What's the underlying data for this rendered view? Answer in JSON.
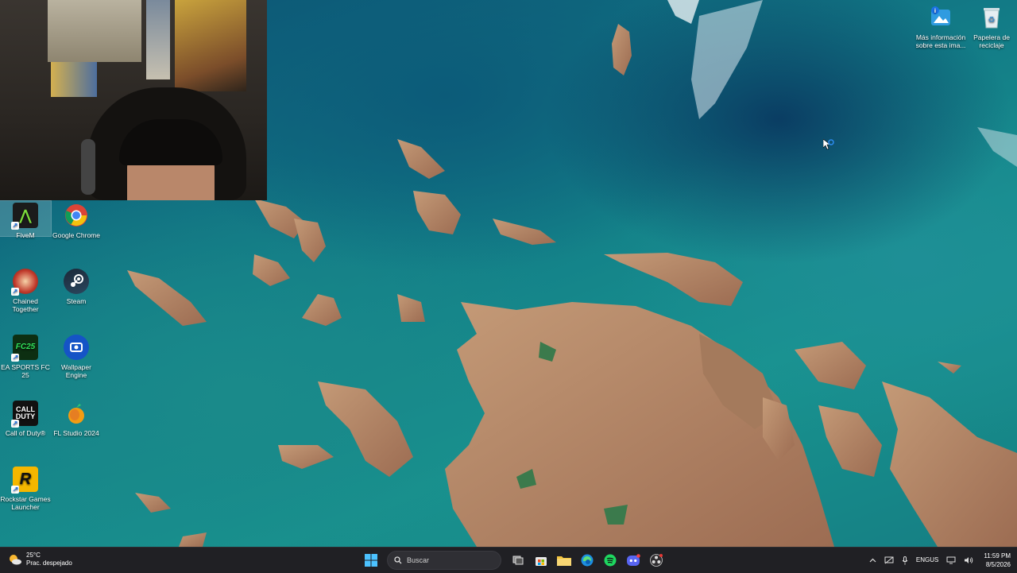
{
  "desktop": {
    "left_icons": [
      {
        "label": "FiveM",
        "icon": "fivem-icon",
        "glyph": "⋀",
        "bg": "#1b1b1b",
        "fg": "#7cdc3c"
      },
      {
        "label": "Google Chrome",
        "icon": "chrome-icon"
      },
      {
        "label": "Chained Together",
        "icon": "chained-together-icon"
      },
      {
        "label": "Steam",
        "icon": "steam-icon"
      },
      {
        "label": "EA SPORTS FC 25",
        "icon": "ea-sports-fc-icon",
        "glyph": "FC25",
        "bg": "#0d2f12",
        "fg": "#31e05a"
      },
      {
        "label": "Wallpaper Engine",
        "icon": "wallpaper-engine-icon"
      },
      {
        "label": "Call of Duty®",
        "icon": "call-of-duty-icon",
        "glyph": "CALL DUTY",
        "bg": "#111111",
        "fg": "#ffffff"
      },
      {
        "label": "FL Studio 2024",
        "icon": "fl-studio-icon"
      },
      {
        "label": "Rockstar Games Launcher",
        "icon": "rockstar-icon",
        "glyph": "R",
        "bg": "#f5b700",
        "fg": "#111111"
      }
    ],
    "right_icons": [
      {
        "label": "Más información sobre esta ima...",
        "icon": "spotlight-info-icon"
      },
      {
        "label": "Papelera de reciclaje",
        "icon": "recycle-bin-icon"
      }
    ]
  },
  "taskbar": {
    "weather": {
      "temp": "25°C",
      "desc": "Prac. despejado",
      "icon": "weather-sun-cloud-icon"
    },
    "search_placeholder": "Buscar",
    "pinned": [
      {
        "name": "start",
        "icon": "windows-start-icon"
      },
      {
        "name": "task-view",
        "icon": "task-view-icon"
      },
      {
        "name": "store",
        "icon": "microsoft-store-icon"
      },
      {
        "name": "file-explorer",
        "icon": "folder-icon"
      },
      {
        "name": "edge",
        "icon": "edge-icon"
      },
      {
        "name": "spotify",
        "icon": "spotify-icon"
      },
      {
        "name": "discord",
        "icon": "discord-icon"
      },
      {
        "name": "obs",
        "icon": "obs-icon"
      }
    ],
    "tray": {
      "language_top": "ENG",
      "language_bottom": "US",
      "time": "11:59 PM",
      "date": "8/5/2026"
    }
  },
  "colors": {
    "taskbar_bg": "#202024",
    "accent": "#0078d4"
  }
}
